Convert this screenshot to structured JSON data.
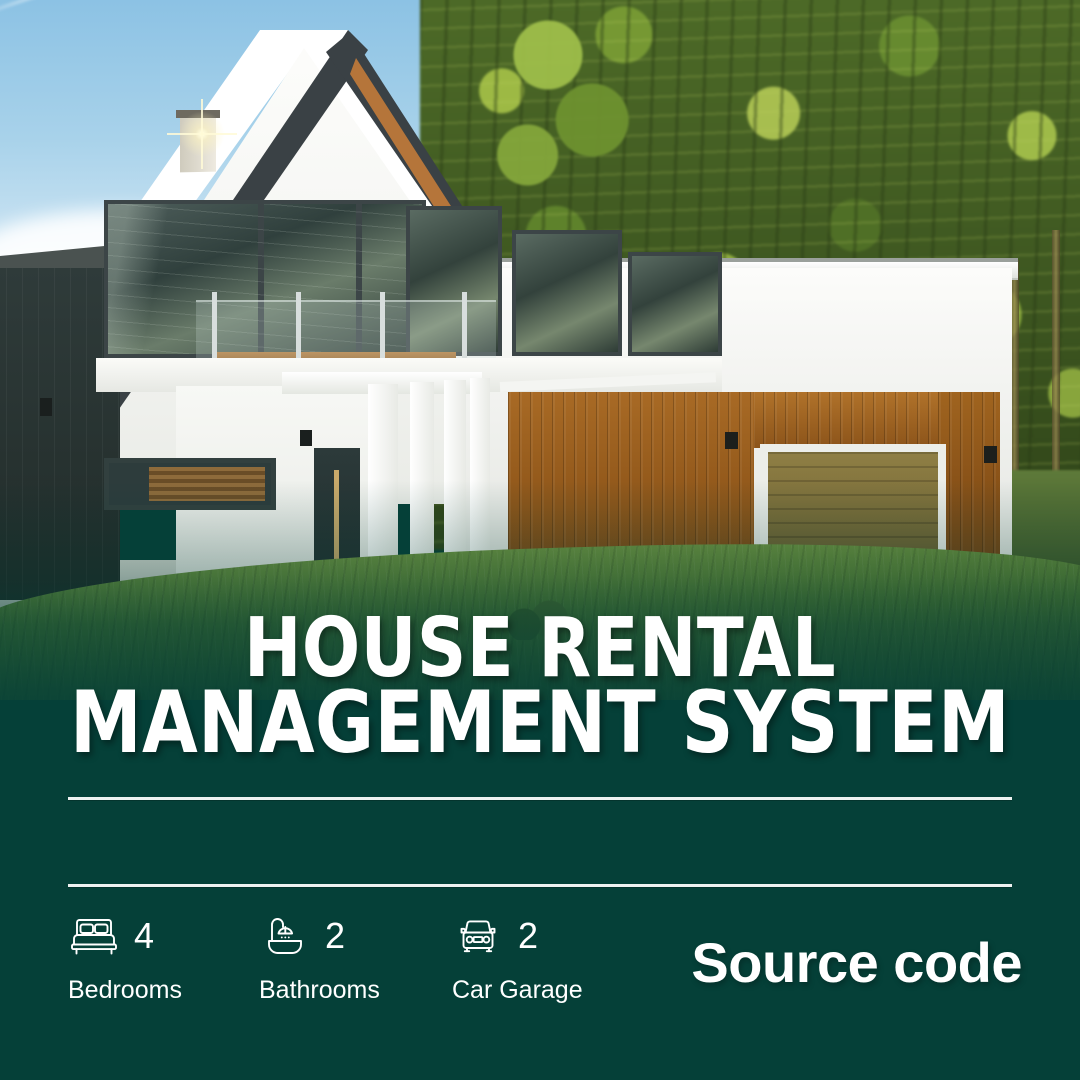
{
  "poster": {
    "title_line1": "HOUSE RENTAL",
    "title_line2": "MANAGEMENT SYSTEM",
    "cta_label": "Source code",
    "brand_color": "#054038",
    "text_color": "#ffffff"
  },
  "photo": {
    "alt": "modern white house with gabled roof, wooden garage and green lawn"
  },
  "stats": [
    {
      "icon": "bed-icon",
      "value": "4",
      "label": "Bedrooms"
    },
    {
      "icon": "bathtub-icon",
      "value": "2",
      "label": "Bathrooms"
    },
    {
      "icon": "car-icon",
      "value": "2",
      "label": "Car Garage"
    }
  ]
}
